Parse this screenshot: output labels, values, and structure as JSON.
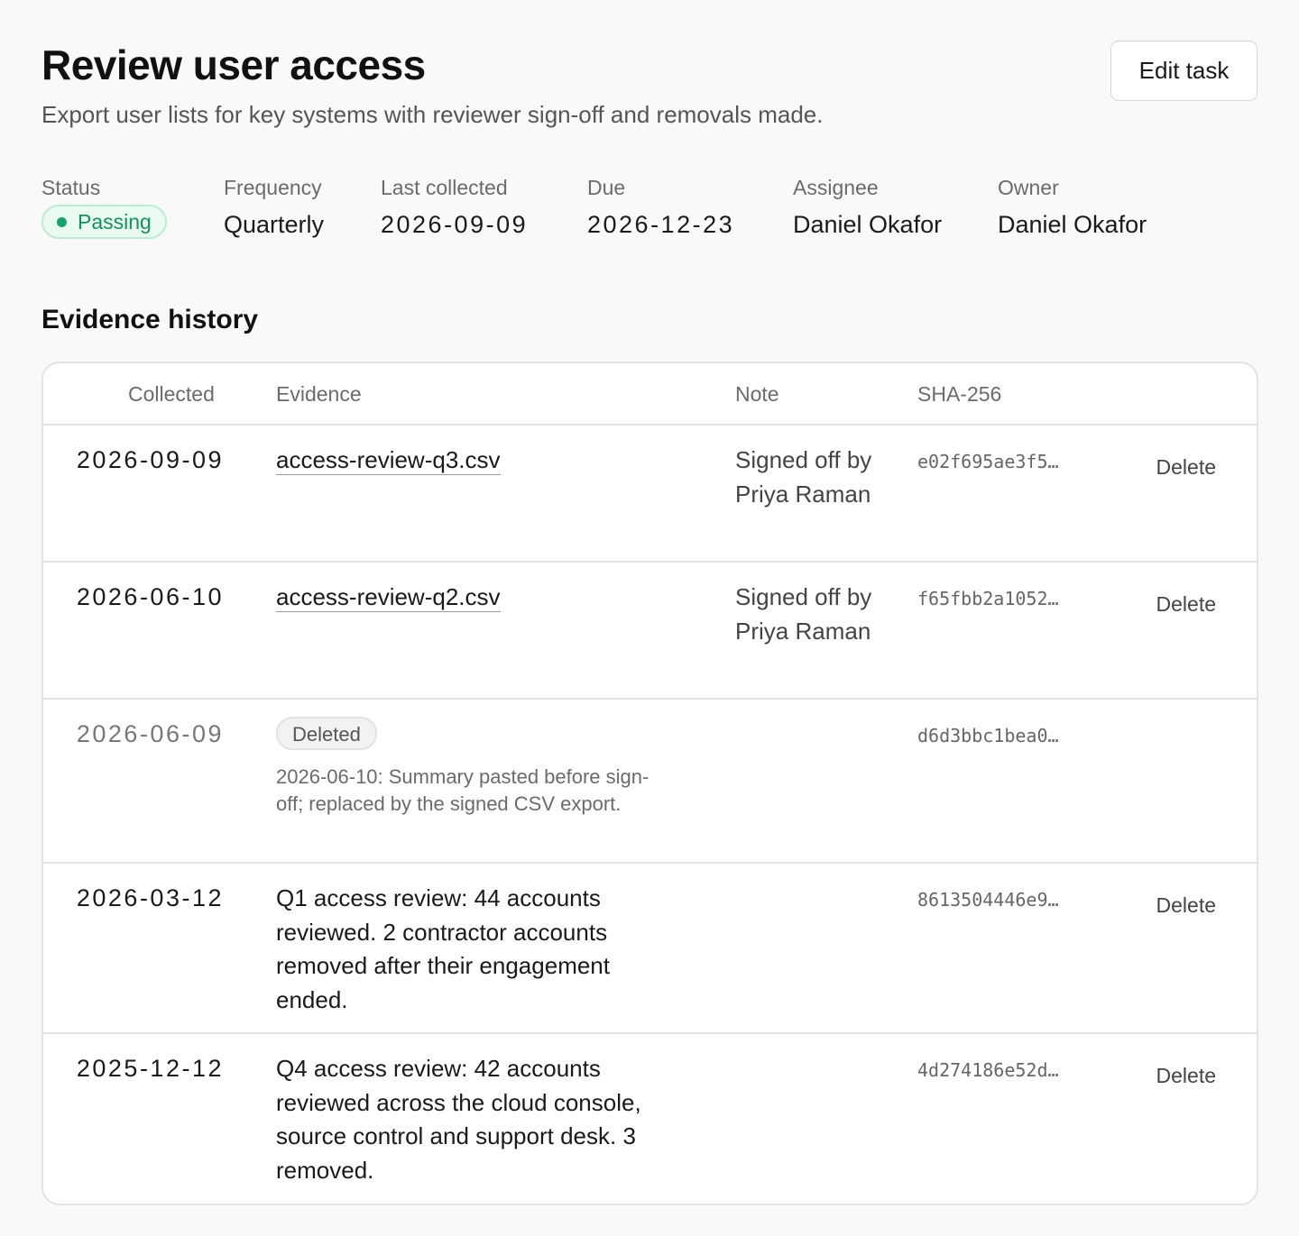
{
  "header": {
    "title": "Review user access",
    "subtitle": "Export user lists for key systems with reviewer sign-off and removals made.",
    "edit_label": "Edit task"
  },
  "meta": {
    "status": {
      "label": "Status",
      "value": "Passing",
      "color": "#13915c"
    },
    "frequency": {
      "label": "Frequency",
      "value": "Quarterly"
    },
    "last_collected": {
      "label": "Last collected",
      "value": "2026-09-09"
    },
    "due": {
      "label": "Due",
      "value": "2026-12-23"
    },
    "assignee": {
      "label": "Assignee",
      "value": "Daniel Okafor"
    },
    "owner": {
      "label": "Owner",
      "value": "Daniel Okafor"
    }
  },
  "evidence": {
    "section_title": "Evidence history",
    "columns": {
      "collected": "Collected",
      "evidence": "Evidence",
      "note": "Note",
      "sha": "SHA-256"
    },
    "rows": [
      {
        "collected": "2026-09-09",
        "evidence": "access-review-q3.csv",
        "note": "Signed off by Priya Raman",
        "sha": "e02f695ae3f5…",
        "action": "Delete"
      },
      {
        "collected": "2026-06-10",
        "evidence": "access-review-q2.csv",
        "note": "Signed off by Priya Raman",
        "sha": "f65fbb2a1052…",
        "action": "Delete"
      },
      {
        "collected": "2026-06-09",
        "badge": "Deleted",
        "deleted_note": "2026-06-10: Summary pasted before sign-off; replaced by the signed CSV export.",
        "sha": "d6d3bbc1bea0…"
      },
      {
        "collected": "2026-03-12",
        "evidence": "Q1 access review: 44 accounts reviewed. 2 contractor accounts removed after their engagement ended.",
        "sha": "8613504446e9…",
        "action": "Delete"
      },
      {
        "collected": "2025-12-12",
        "evidence": "Q4 access review: 42 accounts reviewed across the cloud console, source control and support desk. 3 removed.",
        "sha": "4d274186e52d…",
        "action": "Delete"
      }
    ]
  }
}
